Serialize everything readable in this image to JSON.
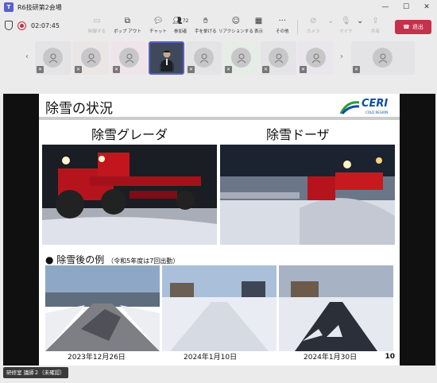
{
  "window": {
    "title": "R6技研第2会場"
  },
  "toolbar": {
    "timer": "02:07:45",
    "view_mode": "制御する",
    "popout": "ポップ アウト",
    "chat": "チャット",
    "people": "参加者",
    "people_count": "72",
    "raise_hand": "手を挙げる",
    "reactions": "リアクションする",
    "view": "表示",
    "more": "その他",
    "camera": "カメラ",
    "mic": "マイク",
    "share": "共有",
    "leave": "退出"
  },
  "slide": {
    "title": "除雪の状況",
    "logo": "CERI",
    "logo_sub": "COLD REGION",
    "left_head": "除雪グレーダ",
    "right_head": "除雪ドーザ",
    "bullet": "● 除雪後の例",
    "bullet_note": "（令和5年度は7回出動）",
    "dates": [
      "2023年12月26日",
      "2024年1月10日",
      "2024年1月30日"
    ],
    "page": "10"
  },
  "status": {
    "presenter": "研修室 議師２（未確認）"
  },
  "colors": {
    "accent": "#5b5fc7",
    "leave": "#c4314b",
    "ceri_blue": "#0d4ea0"
  }
}
